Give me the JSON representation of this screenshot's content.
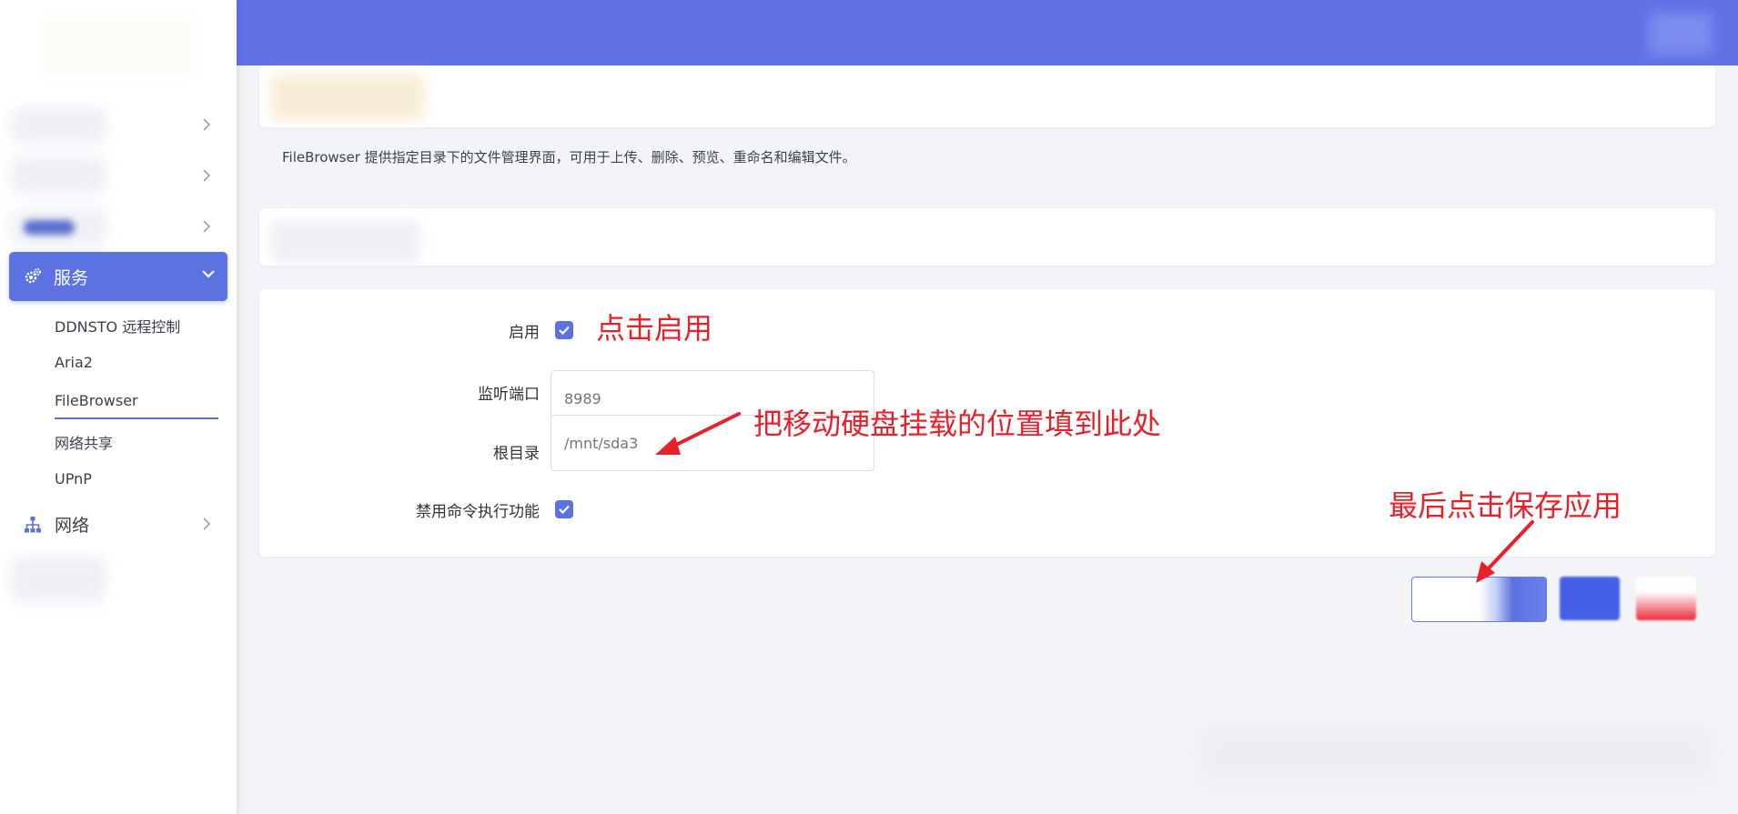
{
  "app": {
    "accent_color": "#5b72e0",
    "header_color": "#6072e6",
    "annotation_color": "#e8202a"
  },
  "sidebar": {
    "active_menu": {
      "label": "服务",
      "icon": "gear-icon"
    },
    "sub_items": [
      {
        "label": "DDNSTO 远程控制",
        "active": false
      },
      {
        "label": "Aria2",
        "active": false
      },
      {
        "label": "FileBrowser",
        "active": true
      },
      {
        "label": "网络共享",
        "active": false
      },
      {
        "label": "UPnP",
        "active": false
      }
    ],
    "network_menu": {
      "label": "网络",
      "icon": "network-icon"
    }
  },
  "page": {
    "description": "FileBrowser 提供指定目录下的文件管理界面，可用于上传、删除、预览、重命名和编辑文件。"
  },
  "form": {
    "enable": {
      "label": "启用",
      "checked": true
    },
    "port": {
      "label": "监听端口",
      "placeholder": "8989",
      "value": ""
    },
    "root_dir": {
      "label": "根目录",
      "placeholder": "/mnt/sda3",
      "value": ""
    },
    "disable_exec": {
      "label": "禁用命令执行功能",
      "checked": true
    }
  },
  "annotations": {
    "click_enable": "点击启用",
    "fill_mount": "把移动硬盘挂载的位置填到此处",
    "save_apply": "最后点击保存应用"
  }
}
